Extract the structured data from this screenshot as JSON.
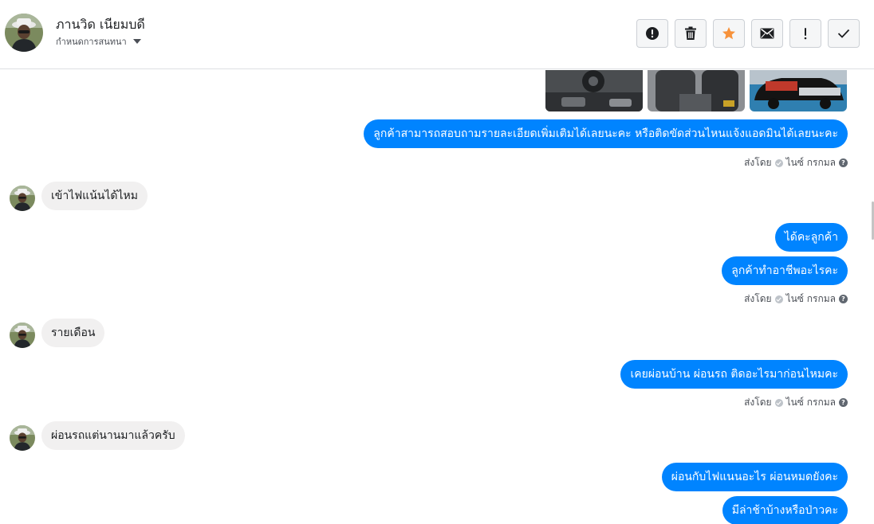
{
  "header": {
    "name": "ภานวิด เนียมบดี",
    "assign_label": "กำหนดการสนทนา",
    "avatar_icon": "user-avatar-icon"
  },
  "actions": [
    {
      "name": "report-spam-button",
      "icon": "alert-circle-icon"
    },
    {
      "name": "delete-button",
      "icon": "trash-icon"
    },
    {
      "name": "star-button",
      "icon": "star-icon",
      "color": "#f7923b"
    },
    {
      "name": "mark-unread-button",
      "icon": "envelope-icon"
    },
    {
      "name": "mark-important-button",
      "icon": "exclamation-icon"
    },
    {
      "name": "mark-done-button",
      "icon": "check-icon"
    }
  ],
  "messages": {
    "m1": "ลูกค้าสามารถสอบถามรายละเอียดเพิ่มเติมได้เลยนะคะ หรือติดขัดส่วนไหนแจ้งแอดมินได้เลยนะคะ",
    "m2": "เข้าไฟแน้นได้ไหม",
    "m3": "ได้คะลูกค้า",
    "m4": "ลูกค้าทำอาชีพอะไรคะ",
    "m5": "รายเดือน",
    "m6": "เคยผ่อนบ้าน ผ่อนรถ ติดอะไรมาก่อนไหมคะ",
    "m7": "ผ่อนรถแต่นานมาแล้วครับ",
    "m8": "ผ่อนกับไฟแนนอะไร ผ่อนหมดยังคะ",
    "m9": "มีล่าช้าบ้างหรือป่าวคะ"
  },
  "sent_by": {
    "label": "ส่งโดย",
    "agent": "ไนซ์ กรกมล"
  },
  "colors": {
    "outgoing_bubble": "#0084ff",
    "incoming_bubble": "#f1f0f0",
    "star": "#f7923b"
  }
}
